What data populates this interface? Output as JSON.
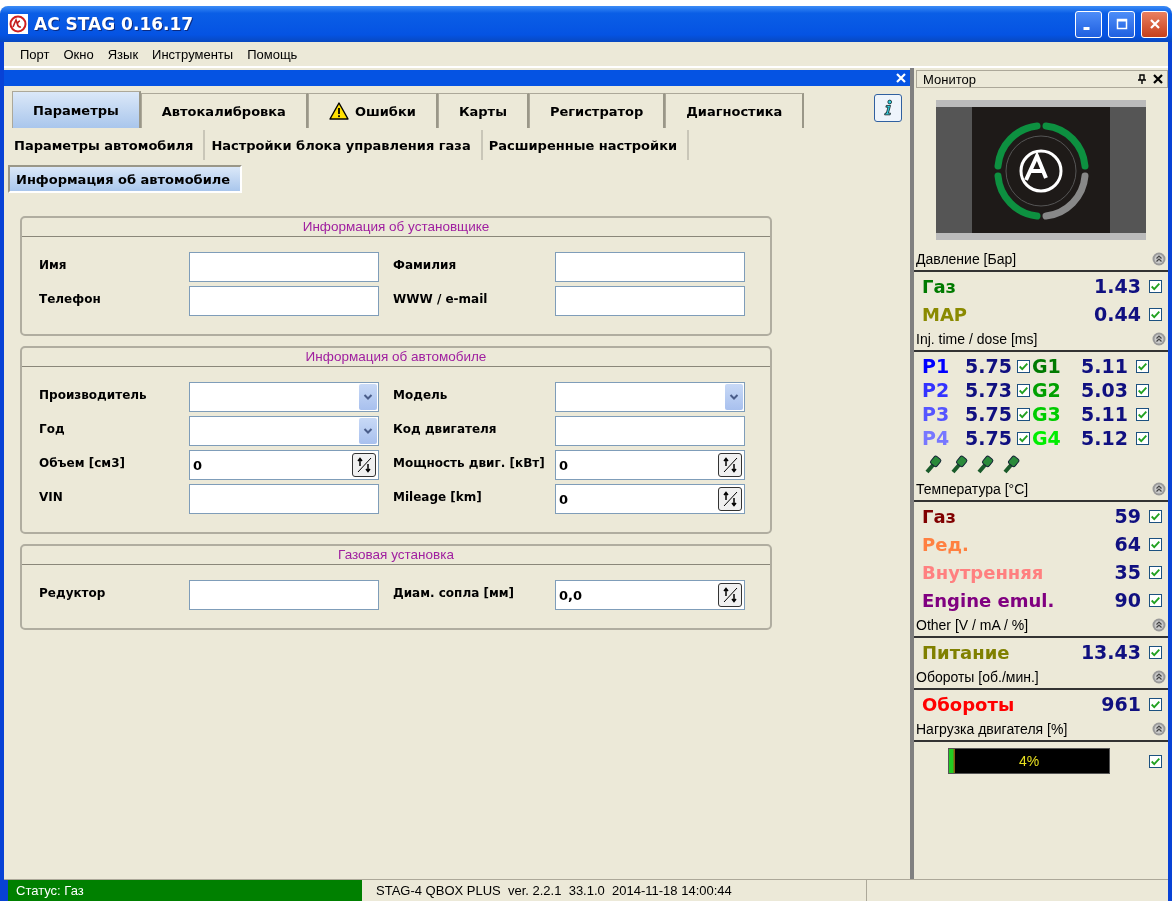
{
  "window": {
    "title": "AC STAG 0.16.17"
  },
  "menu": [
    "Порт",
    "Окно",
    "Язык",
    "Инструменты",
    "Помощь"
  ],
  "tabs": [
    {
      "label": "Параметры",
      "selected": true,
      "kind": "plain"
    },
    {
      "label": "Автокалибровка",
      "selected": false,
      "kind": "plain"
    },
    {
      "label": "Ошибки",
      "selected": false,
      "kind": "warning"
    },
    {
      "label": "Карты",
      "selected": false,
      "kind": "plain"
    },
    {
      "label": "Регистратор",
      "selected": false,
      "kind": "plain"
    },
    {
      "label": "Диагностика",
      "selected": false,
      "kind": "plain"
    }
  ],
  "subtab_rows": [
    {
      "items": [
        {
          "label": "Параметры автомобиля",
          "selected": false
        },
        {
          "label": "Настройки блока управления газа",
          "selected": false
        },
        {
          "label": "Расширенные настройки",
          "selected": false
        }
      ]
    },
    {
      "items": [
        {
          "label": "Информация об автомобиле",
          "selected": true
        }
      ]
    }
  ],
  "groups": [
    {
      "title": "Информация об установщике",
      "fields": [
        {
          "label": "Имя",
          "kind": "text"
        },
        {
          "label": "Фамилия",
          "kind": "text"
        },
        {
          "label": "Телефон",
          "kind": "text"
        },
        {
          "label": "WWW / e-mail",
          "kind": "text"
        }
      ]
    },
    {
      "title": "Информация об автомобиле",
      "fields": [
        {
          "label": "Производитель",
          "kind": "combo"
        },
        {
          "label": "Модель",
          "kind": "combo"
        },
        {
          "label": "Год",
          "kind": "combo"
        },
        {
          "label": "Код двигателя",
          "kind": "text"
        },
        {
          "label": "Объем [см3]",
          "kind": "spin",
          "value": "0"
        },
        {
          "label": "Мощность двиг. [кВт]",
          "kind": "spin",
          "value": "0"
        },
        {
          "label": "VIN",
          "kind": "text"
        },
        {
          "label": "Mileage [km]",
          "kind": "spin",
          "value": "0"
        }
      ]
    },
    {
      "title": "Газовая установка",
      "fields": [
        {
          "label": "Редуктор",
          "kind": "text"
        },
        {
          "label": "Диам. сопла [мм]",
          "kind": "spin",
          "value": "0,0"
        }
      ]
    }
  ],
  "monitor": {
    "title": "Монитор",
    "sections": [
      {
        "title": "Давление [Бар]",
        "kind": "values",
        "rows": [
          {
            "label": "Газ",
            "color": "#007a00",
            "value": "1.43",
            "checked": true
          },
          {
            "label": "MAP",
            "color": "#8a8a00",
            "value": "0.44",
            "checked": true
          }
        ]
      },
      {
        "title": "Inj. time / dose [ms]",
        "kind": "injectors",
        "rows": [
          {
            "petrol": {
              "label": "P1",
              "color": "#0000ff",
              "value": "5.75",
              "checked": true
            },
            "gas": {
              "label": "G1",
              "color": "#007a00",
              "value": "5.11",
              "checked": true
            }
          },
          {
            "petrol": {
              "label": "P2",
              "color": "#3333ff",
              "value": "5.73",
              "checked": true
            },
            "gas": {
              "label": "G2",
              "color": "#00a000",
              "value": "5.03",
              "checked": true
            }
          },
          {
            "petrol": {
              "label": "P3",
              "color": "#5555ff",
              "value": "5.75",
              "checked": true
            },
            "gas": {
              "label": "G3",
              "color": "#00cc00",
              "value": "5.11",
              "checked": true
            }
          },
          {
            "petrol": {
              "label": "P4",
              "color": "#7777ff",
              "value": "5.75",
              "checked": true
            },
            "gas": {
              "label": "G4",
              "color": "#00ee00",
              "value": "5.12",
              "checked": true
            }
          }
        ]
      },
      {
        "title": "Температура [°C]",
        "kind": "values",
        "rows": [
          {
            "label": "Газ",
            "color": "#800000",
            "value": "59",
            "checked": true
          },
          {
            "label": "Ред.",
            "color": "#ff8040",
            "value": "64",
            "checked": true
          },
          {
            "label": "Внутренняя",
            "color": "#ff8080",
            "value": "35",
            "checked": true
          },
          {
            "label": "Engine emul.",
            "color": "#800080",
            "value": "90",
            "checked": true
          }
        ]
      },
      {
        "title": "Other [V / mA / %]",
        "kind": "values",
        "rows": [
          {
            "label": "Питание",
            "color": "#808000",
            "value": "13.43",
            "checked": true
          }
        ]
      },
      {
        "title": "Обороты [об./мин.]",
        "kind": "values",
        "rows": [
          {
            "label": "Обороты",
            "color": "#ff0000",
            "value": "961",
            "checked": true
          }
        ]
      },
      {
        "title": "Нагрузка двигателя [%]",
        "kind": "bar",
        "level": 0.04,
        "reading": "4%",
        "checked": true
      }
    ]
  },
  "status_bar": {
    "status": "Статус: Газ",
    "info": "STAG-4 QBOX PLUS  ver. 2.2.1  33.1.0  2014-11-18 14:00:44"
  }
}
